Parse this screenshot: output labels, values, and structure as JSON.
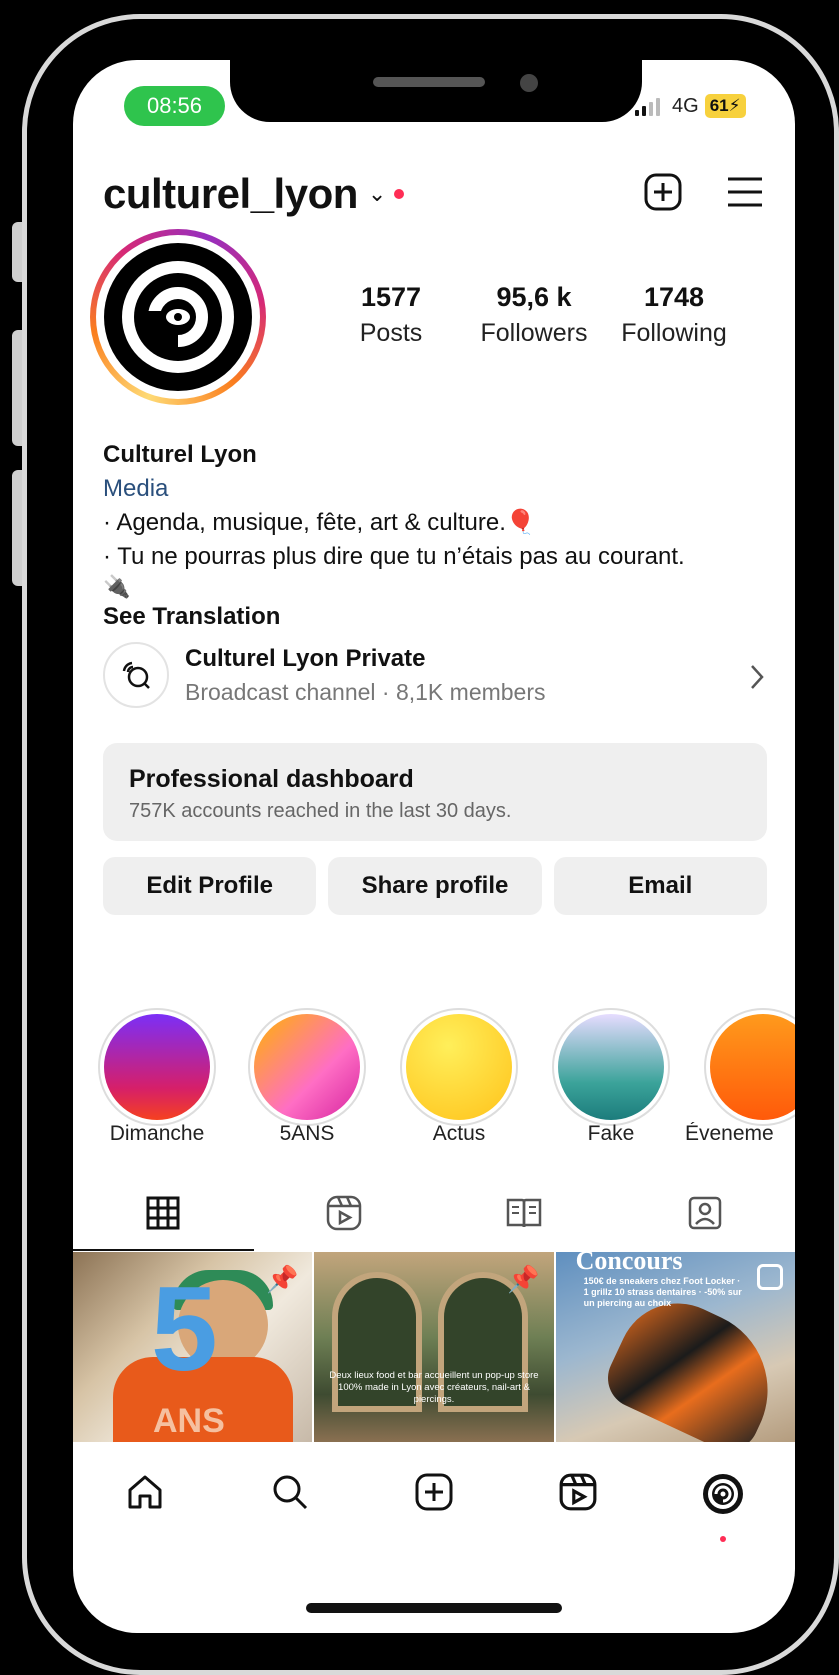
{
  "status": {
    "time": "08:56",
    "network": "4G",
    "battery": "61"
  },
  "header": {
    "username": "culturel_lyon"
  },
  "profile": {
    "stats": [
      {
        "num": "1577",
        "label": "Posts"
      },
      {
        "num": "95,6 k",
        "label": "Followers"
      },
      {
        "num": "1748",
        "label": "Following"
      }
    ],
    "name": "Culturel Lyon",
    "category": "Media",
    "bio_line1": "· Agenda, musique, fête, art & culture.",
    "bio_line1_emoji": "🎈",
    "bio_line2": "· Tu ne pourras plus dire que tu n’étais pas au courant.",
    "bio_line3_emoji": "🔌",
    "see_translation": "See Translation"
  },
  "broadcast": {
    "title": "Culturel Lyon Private",
    "subtitle": "Broadcast channel · 8,1K members"
  },
  "dashboard": {
    "title": "Professional dashboard",
    "subtitle": "757K accounts reached in the last 30 days."
  },
  "actions": {
    "edit": "Edit Profile",
    "share": "Share profile",
    "email": "Email"
  },
  "highlights": [
    {
      "label": "Dimanche"
    },
    {
      "label": "5ANS"
    },
    {
      "label": "Actus"
    },
    {
      "label": "Fake"
    },
    {
      "label": "Éveneme"
    }
  ],
  "grid": {
    "post1_number": "5",
    "post1_text": "ANS",
    "post2_caption": "Deux lieux food et bar accueillent un pop-up store 100% made in Lyon avec créateurs, nail-art & piercings.",
    "post3_title": "Concours",
    "post3_promo": "150€ de sneakers chez Foot Locker · 1 grillz 10 strass dentaires · -50% sur un piercing au choix"
  },
  "colors": {
    "accent_red": "#ff2d55",
    "time_pill": "#2fc44d",
    "category_link": "#2a4f7c",
    "battery": "#f7d13d"
  }
}
